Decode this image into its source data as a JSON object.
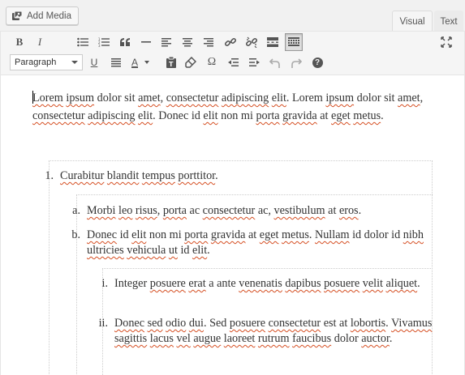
{
  "toolbar_top": {
    "add_media_label": "Add Media",
    "tabs": [
      {
        "label": "Visual",
        "active": true
      },
      {
        "label": "Text",
        "active": false
      }
    ]
  },
  "toolbar": {
    "row1": [
      "bold",
      "italic",
      "bulleted-list",
      "numbered-list",
      "blockquote",
      "horizontal-line",
      "align-left",
      "align-center",
      "align-right",
      "insert-link",
      "remove-link",
      "read-more",
      "toolbar-toggle",
      "fullscreen"
    ],
    "bold_label": "B",
    "italic_label": "I",
    "format_select_value": "Paragraph",
    "underline_label": "U",
    "text_color_label": "A",
    "omega_label": "Ω",
    "help_label": "?"
  },
  "content": {
    "paragraph": [
      {
        "t": "Lorem",
        "sp": true
      },
      {
        "t": " ",
        "sp": false
      },
      {
        "t": "ipsum",
        "sp": true
      },
      {
        "t": " dolor sit ",
        "sp": false
      },
      {
        "t": "amet",
        "sp": true
      },
      {
        "t": ", ",
        "sp": false
      },
      {
        "t": "consectetur",
        "sp": true
      },
      {
        "t": " ",
        "sp": false
      },
      {
        "t": "adipiscing",
        "sp": true
      },
      {
        "t": " ",
        "sp": false
      },
      {
        "t": "elit",
        "sp": true
      },
      {
        "t": ". Lorem ",
        "sp": false
      },
      {
        "t": "ipsum",
        "sp": true
      },
      {
        "t": " dolor sit ",
        "sp": false
      },
      {
        "t": "amet",
        "sp": true
      },
      {
        "t": ", ",
        "sp": false
      },
      {
        "t": "consectetur",
        "sp": true
      },
      {
        "t": " ",
        "sp": false
      },
      {
        "t": "adipiscing",
        "sp": true
      },
      {
        "t": " ",
        "sp": false
      },
      {
        "t": "elit",
        "sp": true
      },
      {
        "t": ". Donec id ",
        "sp": false
      },
      {
        "t": "elit",
        "sp": true
      },
      {
        "t": " non mi ",
        "sp": false
      },
      {
        "t": "porta",
        "sp": true
      },
      {
        "t": " ",
        "sp": false
      },
      {
        "t": "gravida",
        "sp": true
      },
      {
        "t": " at ",
        "sp": false
      },
      {
        "t": "eget",
        "sp": true
      },
      {
        "t": " ",
        "sp": false
      },
      {
        "t": "metus",
        "sp": true
      },
      {
        "t": ".",
        "sp": false
      }
    ],
    "list_items": [
      {
        "marker": "1.",
        "runs": [
          {
            "t": "Curabitur",
            "sp": true
          },
          {
            "t": " ",
            "sp": false
          },
          {
            "t": "blandit",
            "sp": true
          },
          {
            "t": " ",
            "sp": false
          },
          {
            "t": "tempus",
            "sp": true
          },
          {
            "t": " ",
            "sp": false
          },
          {
            "t": "porttitor",
            "sp": true
          },
          {
            "t": ".",
            "sp": false
          }
        ]
      },
      {
        "marker": "a.",
        "runs": [
          {
            "t": "Morbi",
            "sp": true
          },
          {
            "t": " ",
            "sp": false
          },
          {
            "t": "leo",
            "sp": true
          },
          {
            "t": " ",
            "sp": false
          },
          {
            "t": "risus",
            "sp": true
          },
          {
            "t": ", ",
            "sp": false
          },
          {
            "t": "porta",
            "sp": true
          },
          {
            "t": " ac ",
            "sp": false
          },
          {
            "t": "consectetur",
            "sp": true
          },
          {
            "t": " ac, ",
            "sp": false
          },
          {
            "t": "vestibulum",
            "sp": true
          },
          {
            "t": " at ",
            "sp": false
          },
          {
            "t": "eros",
            "sp": true
          },
          {
            "t": ".",
            "sp": false
          }
        ]
      },
      {
        "marker": "b.",
        "runs": [
          {
            "t": "Donec",
            "sp": true
          },
          {
            "t": " id ",
            "sp": false
          },
          {
            "t": "elit",
            "sp": true
          },
          {
            "t": " non mi ",
            "sp": false
          },
          {
            "t": "porta",
            "sp": true
          },
          {
            "t": " ",
            "sp": false
          },
          {
            "t": "gravida",
            "sp": true
          },
          {
            "t": " at ",
            "sp": false
          },
          {
            "t": "eget",
            "sp": true
          },
          {
            "t": " ",
            "sp": false
          },
          {
            "t": "metus",
            "sp": true
          },
          {
            "t": ". ",
            "sp": false
          },
          {
            "t": "Nullam",
            "sp": true
          },
          {
            "t": " id dolor id ",
            "sp": false
          },
          {
            "t": "nibh",
            "sp": true
          },
          {
            "t": " ",
            "sp": false
          },
          {
            "t": "ultricies",
            "sp": true
          },
          {
            "t": " ",
            "sp": false
          },
          {
            "t": "vehicula",
            "sp": true
          },
          {
            "t": " ",
            "sp": false
          },
          {
            "t": "ut",
            "sp": true
          },
          {
            "t": " id ",
            "sp": false
          },
          {
            "t": "elit",
            "sp": true
          },
          {
            "t": ".",
            "sp": false
          }
        ]
      },
      {
        "marker": "i.",
        "runs": [
          {
            "t": "Integer ",
            "sp": false
          },
          {
            "t": "posuere",
            "sp": true
          },
          {
            "t": " ",
            "sp": false
          },
          {
            "t": "erat",
            "sp": true
          },
          {
            "t": " a ante ",
            "sp": false
          },
          {
            "t": "venenatis",
            "sp": true
          },
          {
            "t": " ",
            "sp": false
          },
          {
            "t": "dapibus",
            "sp": true
          },
          {
            "t": " ",
            "sp": false
          },
          {
            "t": "posuere",
            "sp": true
          },
          {
            "t": " ",
            "sp": false
          },
          {
            "t": "velit",
            "sp": true
          },
          {
            "t": " ",
            "sp": false
          },
          {
            "t": "aliquet",
            "sp": true
          },
          {
            "t": ".",
            "sp": false
          }
        ]
      },
      {
        "marker": "ii.",
        "runs": [
          {
            "t": "Donec",
            "sp": true
          },
          {
            "t": " ",
            "sp": false
          },
          {
            "t": "sed",
            "sp": true
          },
          {
            "t": " ",
            "sp": false
          },
          {
            "t": "odio",
            "sp": true
          },
          {
            "t": " ",
            "sp": false
          },
          {
            "t": "dui",
            "sp": true
          },
          {
            "t": ". Sed ",
            "sp": false
          },
          {
            "t": "posuere",
            "sp": true
          },
          {
            "t": " ",
            "sp": false
          },
          {
            "t": "consectetur",
            "sp": true
          },
          {
            "t": " est at ",
            "sp": false
          },
          {
            "t": "lobortis",
            "sp": true
          },
          {
            "t": ". ",
            "sp": false
          },
          {
            "t": "Vivamus",
            "sp": true
          },
          {
            "t": " ",
            "sp": false
          },
          {
            "t": "sagittis",
            "sp": true
          },
          {
            "t": " ",
            "sp": false
          },
          {
            "t": "lacus",
            "sp": true
          },
          {
            "t": " ",
            "sp": false
          },
          {
            "t": "vel",
            "sp": true
          },
          {
            "t": " ",
            "sp": false
          },
          {
            "t": "augue",
            "sp": true
          },
          {
            "t": " ",
            "sp": false
          },
          {
            "t": "laoreet",
            "sp": true
          },
          {
            "t": " ",
            "sp": false
          },
          {
            "t": "rutrum",
            "sp": true
          },
          {
            "t": " ",
            "sp": false
          },
          {
            "t": "faucibus",
            "sp": true
          },
          {
            "t": " dolor ",
            "sp": false
          },
          {
            "t": "auctor",
            "sp": true
          },
          {
            "t": ".",
            "sp": false
          }
        ]
      }
    ]
  },
  "colors": {
    "spellcheck_underline": "#d54e21",
    "toolbar_bg": "#f5f5f5",
    "page_bg": "#f1f1f1"
  }
}
